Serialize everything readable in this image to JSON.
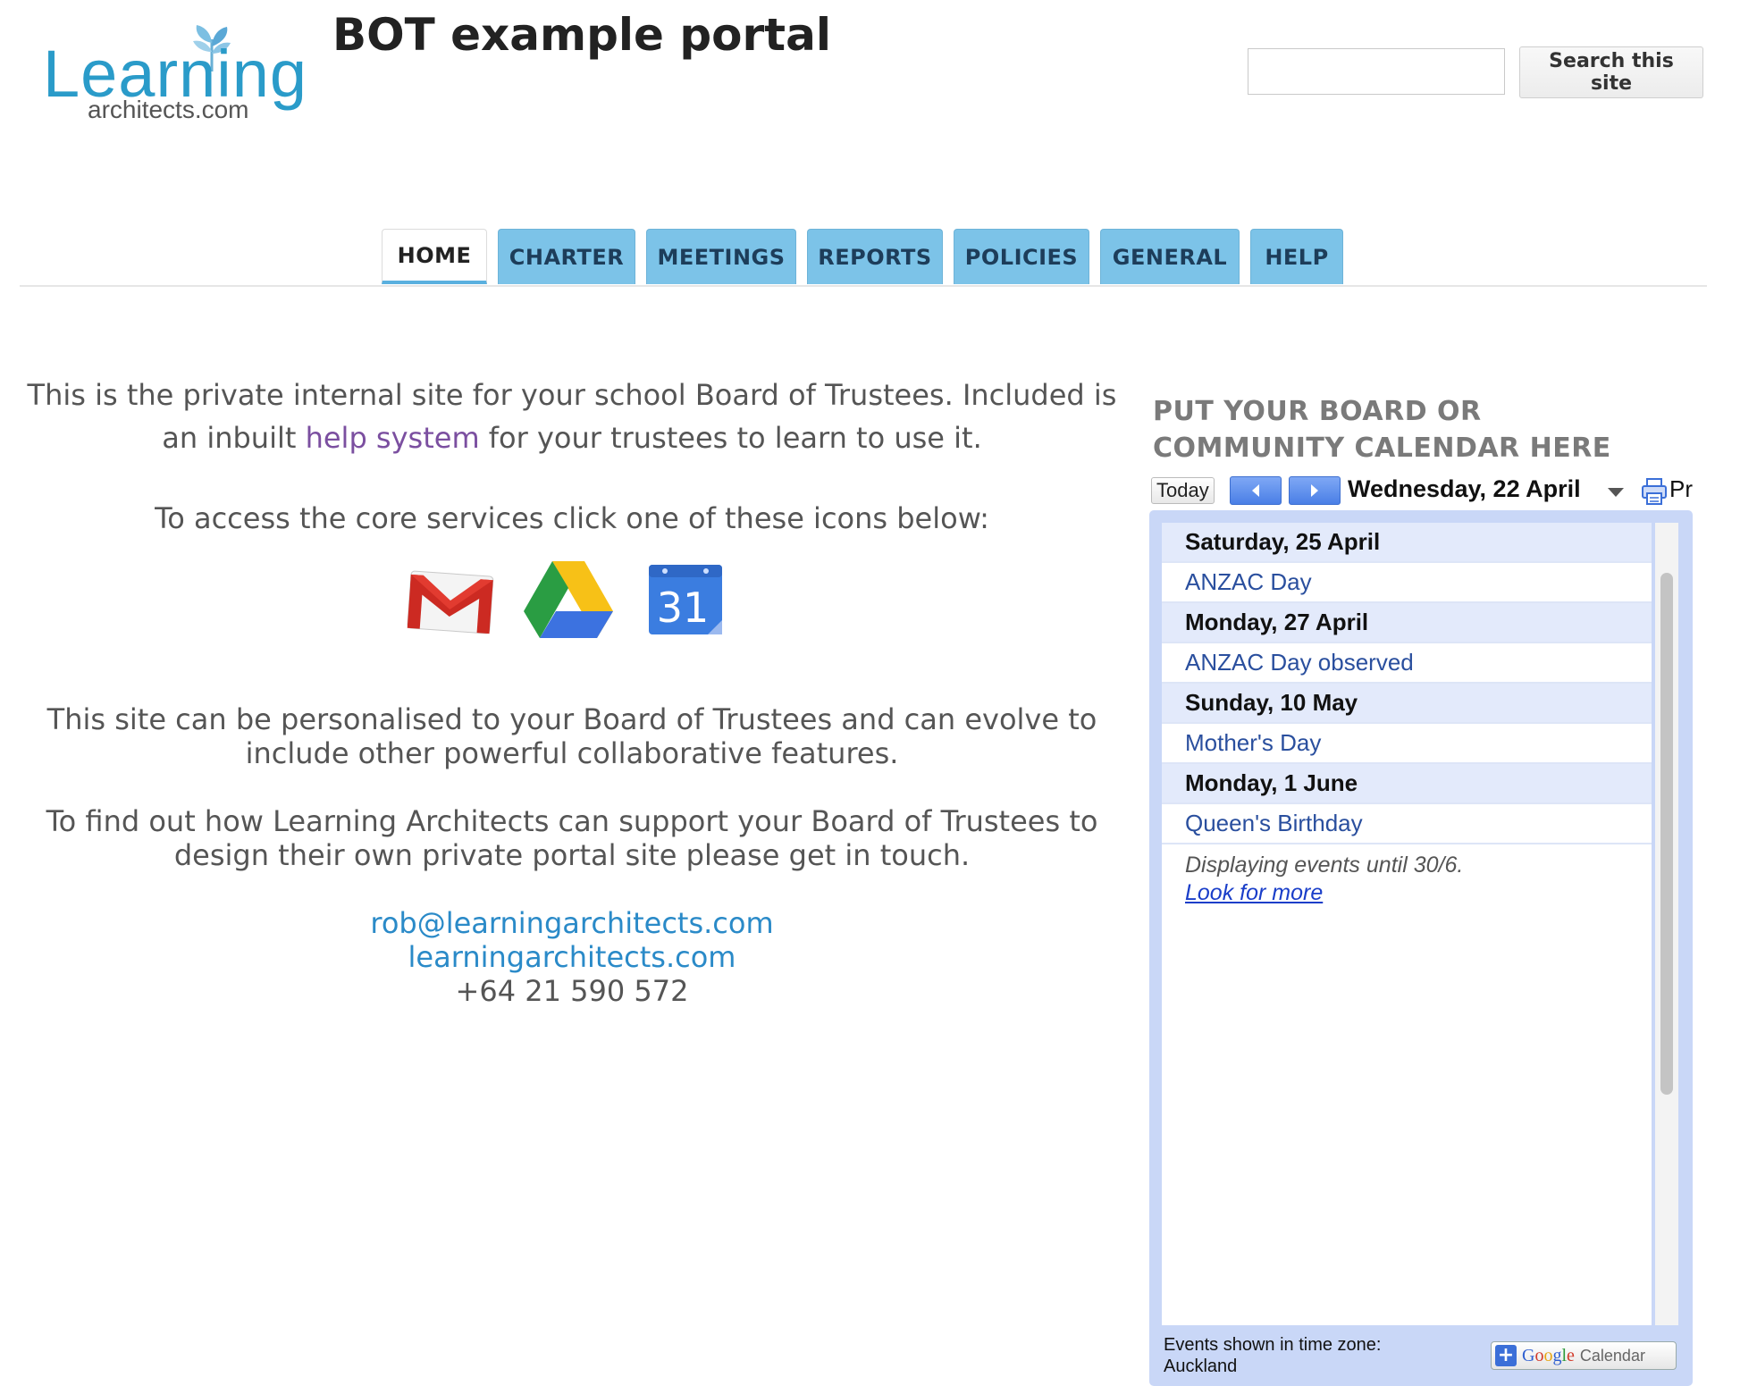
{
  "logo": {
    "word": "Learning",
    "sub": "architects.com"
  },
  "site": {
    "title": "BOT example portal"
  },
  "search": {
    "value": "",
    "placeholder": "",
    "button_label": "Search this site"
  },
  "nav": {
    "tabs": [
      {
        "label": "HOME",
        "active": true
      },
      {
        "label": "CHARTER",
        "active": false
      },
      {
        "label": "MEETINGS",
        "active": false
      },
      {
        "label": "REPORTS",
        "active": false
      },
      {
        "label": "POLICIES",
        "active": false
      },
      {
        "label": "GENERAL",
        "active": false
      },
      {
        "label": "HELP",
        "active": false
      }
    ]
  },
  "main": {
    "intro_before": "This is the private internal site for your school Board of Trustees. Included is an inbuilt ",
    "intro_link": "help system",
    "intro_after": " for your trustees to learn to use it.",
    "access": "To access the core services click one of these icons below:",
    "services": [
      {
        "icon": "gmail-icon"
      },
      {
        "icon": "google-drive-icon"
      },
      {
        "icon": "google-calendar-icon",
        "number": "31"
      }
    ],
    "para2": "This site can be personalised to your Board of Trustees and can evolve to include other powerful collaborative features.",
    "para3": "To find out how Learning Architects can support your Board of Trustees to design their own private portal site please get in touch.",
    "contact": {
      "email": "rob@learningarchitects.com",
      "website": "learningarchitects.com",
      "phone": "+64 21 590 572"
    }
  },
  "calendar": {
    "heading": "PUT YOUR BOARD OR COMMUNITY CALENDAR HERE",
    "today_label": "Today",
    "current_date": "Wednesday, 22 April",
    "print_label": "Pr",
    "entries": [
      {
        "kind": "day",
        "text": "Saturday, 25 April"
      },
      {
        "kind": "event",
        "text": "ANZAC Day"
      },
      {
        "kind": "day",
        "text": "Monday, 27 April"
      },
      {
        "kind": "event",
        "text": "ANZAC Day observed"
      },
      {
        "kind": "day",
        "text": "Sunday, 10 May"
      },
      {
        "kind": "event",
        "text": "Mother's Day"
      },
      {
        "kind": "day",
        "text": "Monday, 1 June"
      },
      {
        "kind": "event",
        "text": "Queen's Birthday"
      }
    ],
    "note": "Displaying events until 30/6.",
    "more_link": "Look for more",
    "tz_line1": "Events shown in time zone:",
    "tz_line2": "Auckland",
    "badge": {
      "google": "Google",
      "calendar": "Calendar"
    }
  },
  "colors": {
    "nav_tab": "#7cc3e8",
    "nav_active_underline": "#5ab0df",
    "link": "#2a8ac8",
    "help_link": "#7b4fa0",
    "calendar_frame": "#c9d7f7",
    "logo_blue": "#2a9bc9"
  }
}
